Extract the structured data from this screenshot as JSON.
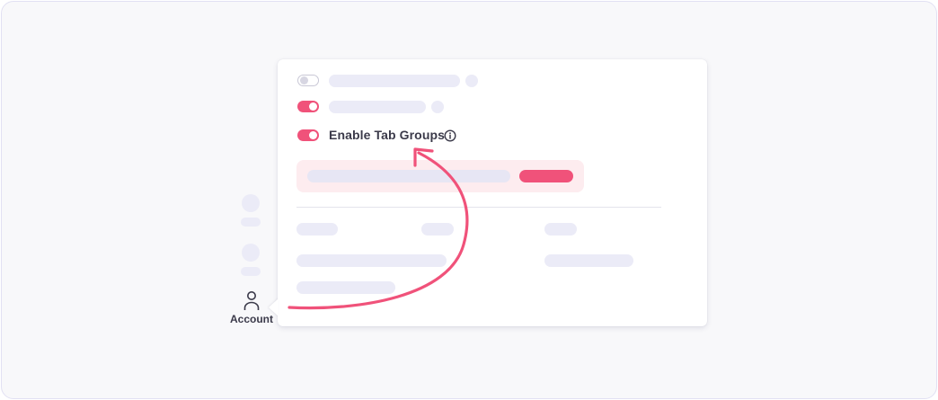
{
  "panel": {
    "setting_label": "Enable Tab Groups",
    "toggles": [
      {
        "state": "off"
      },
      {
        "state": "on"
      },
      {
        "state": "on"
      }
    ]
  },
  "sidebar": {
    "account_label": "Account"
  },
  "icons": {
    "account": "user-icon",
    "info": "info-icon",
    "arrow": "curved-arrow-icon"
  },
  "colors": {
    "accent": "#f0527a",
    "placeholder": "#ebebf7",
    "promo_bg": "#fdecef",
    "text": "#3b3a4a"
  }
}
